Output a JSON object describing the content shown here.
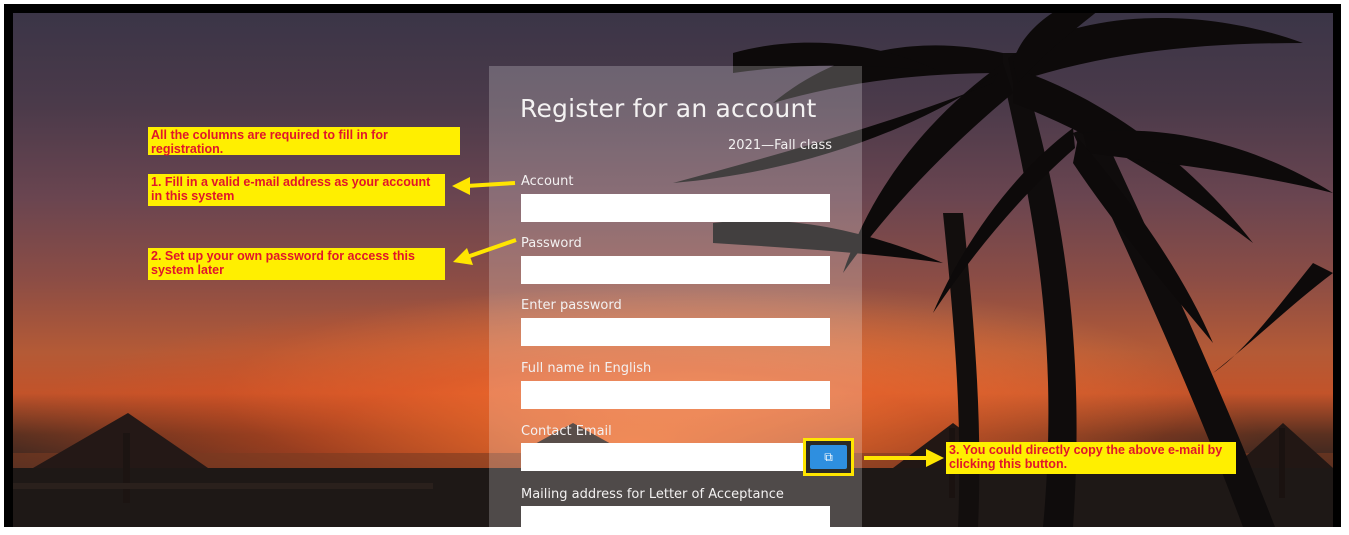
{
  "form": {
    "title": "Register for an account",
    "subtitle": "2021—Fall class",
    "fields": [
      {
        "label": "Account",
        "value": "",
        "placeholder": ""
      },
      {
        "label": "Password",
        "value": "",
        "placeholder": ""
      },
      {
        "label": "Enter password",
        "value": "",
        "placeholder": ""
      },
      {
        "label": "Full name in English",
        "value": "",
        "placeholder": ""
      },
      {
        "label": "Contact Email",
        "value": "",
        "placeholder": ""
      },
      {
        "label": "Mailing address for Letter of Acceptance",
        "value": "",
        "placeholder": ""
      }
    ],
    "copy_button_icon": "copy-icon",
    "copy_button_glyph": "⧉"
  },
  "annotations": {
    "note_required": "All the columns are required to fill in for registration.",
    "note_account": "1. Fill in a valid e-mail address as your account in this system",
    "note_password": "2. Set up your own password for access this system later",
    "note_copy": "3. You could directly copy the above e-mail by clicking this button."
  },
  "colors": {
    "annotation_bg": "#ffef00",
    "annotation_text": "#e0162b",
    "copy_button": "#2e8fe0"
  }
}
